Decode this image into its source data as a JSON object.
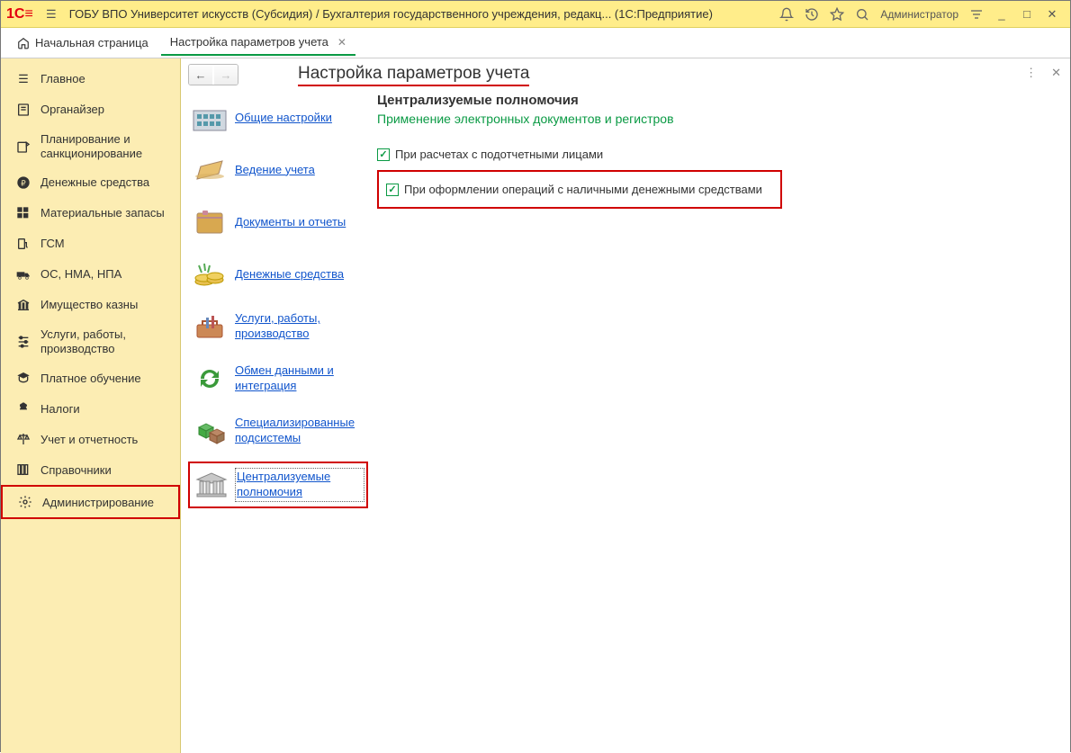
{
  "titlebar": {
    "app_title": "ГОБУ ВПО Университет искусств (Субсидия) / Бухгалтерия государственного учреждения, редакц...   (1С:Предприятие)",
    "user": "Администратор"
  },
  "tabs": {
    "home": "Начальная страница",
    "active": "Настройка параметров учета"
  },
  "sidebar": [
    "Главное",
    "Органайзер",
    "Планирование и санкционирование",
    "Денежные средства",
    "Материальные запасы",
    "ГСМ",
    "ОС, НМА, НПА",
    "Имущество казны",
    "Услуги, работы, производство",
    "Платное обучение",
    "Налоги",
    "Учет и отчетность",
    "Справочники",
    "Администрирование"
  ],
  "page": {
    "title": "Настройка параметров учета"
  },
  "settings_nav": [
    "Общие настройки",
    "Ведение учета",
    "Документы и отчеты",
    "Денежные средства",
    "Услуги, работы, производство",
    "Обмен данными и интеграция",
    "Специализированные подсистемы",
    "Централизуемые полномочия"
  ],
  "pane": {
    "title": "Централизуемые полномочия",
    "subtitle": "Применение электронных документов и регистров",
    "chk1": "При расчетах с подотчетными лицами",
    "chk2": "При оформлении операций с наличными денежными средствами"
  }
}
